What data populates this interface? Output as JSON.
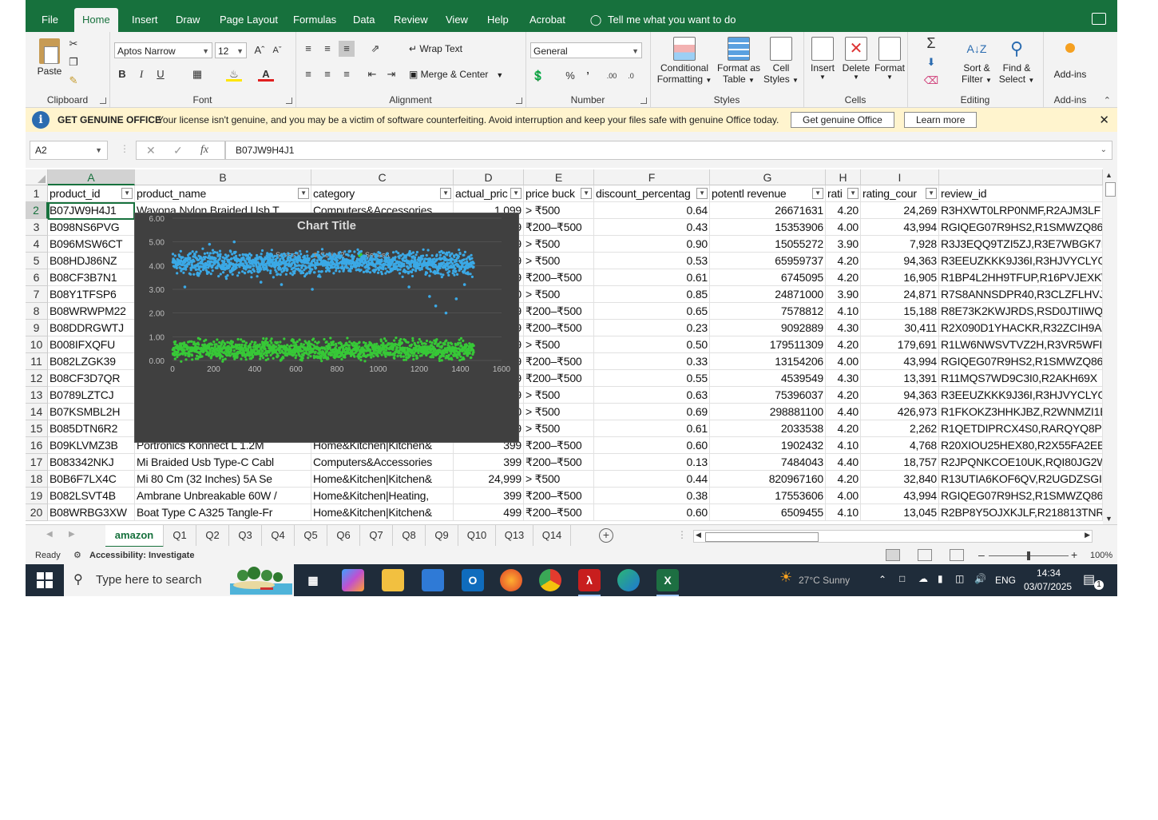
{
  "ribbon": {
    "tabs": [
      "File",
      "Home",
      "Insert",
      "Draw",
      "Page Layout",
      "Formulas",
      "Data",
      "Review",
      "View",
      "Help",
      "Acrobat"
    ],
    "active_tab": "Home",
    "tell_me": "Tell me what you want to do",
    "clipboard": {
      "paste": "Paste",
      "label": "Clipboard"
    },
    "font": {
      "name": "Aptos Narrow",
      "size": "12",
      "bold": "B",
      "italic": "I",
      "underline": "U",
      "label": "Font"
    },
    "alignment": {
      "wrap": "Wrap Text",
      "merge": "Merge & Center",
      "label": "Alignment"
    },
    "number": {
      "format": "General",
      "percent": "%",
      "comma": "’",
      "label": "Number"
    },
    "styles": {
      "conditional": "Conditional",
      "conditional2": "Formatting",
      "format_as": "Format as",
      "format_as2": "Table",
      "cell": "Cell",
      "cell2": "Styles",
      "label": "Styles"
    },
    "cells": {
      "insert": "Insert",
      "delete": "Delete",
      "format": "Format",
      "label": "Cells"
    },
    "editing": {
      "sort": "Sort &",
      "sort2": "Filter",
      "find": "Find &",
      "find2": "Select",
      "label": "Editing"
    },
    "addins": {
      "addins": "Add-ins",
      "label": "Add-ins"
    }
  },
  "banner": {
    "title": "GET GENUINE OFFICE",
    "message": "Your license isn't genuine, and you may be a victim of software counterfeiting. Avoid interruption and keep your files safe with genuine Office today.",
    "get_button": "Get genuine Office",
    "learn_button": "Learn more"
  },
  "formula_bar": {
    "name_box": "A2",
    "fx": "fx",
    "value": "B07JW9H4J1"
  },
  "columns": [
    "A",
    "B",
    "C",
    "D",
    "E",
    "F",
    "G",
    "H",
    "I"
  ],
  "headers": [
    "product_id",
    "product_name",
    "category",
    "actual_pric",
    "price buck",
    "discount_percentag",
    "potentl revenue",
    "rati",
    "rating_cour",
    "review_id"
  ],
  "rows": [
    {
      "n": "2",
      "a": "B07JW9H4J1",
      "b": "Wayona Nylon Braided Usb T",
      "c": "Computers&Accessories",
      "d": "1,099",
      "e": "> ₹500",
      "f": "0.64",
      "g": "26671631",
      "h": "4.20",
      "i": "24,269",
      "j": "R3HXWT0LRP0NMF,R2AJM3LF"
    },
    {
      "n": "3",
      "a": "B098NS6PVG",
      "b": "",
      "c": "",
      "d": "9",
      "e": "₹200–₹500",
      "f": "0.43",
      "g": "15353906",
      "h": "4.00",
      "i": "43,994",
      "j": "RGIQEG07R9HS2,R1SMWZQ86"
    },
    {
      "n": "4",
      "a": "B096MSW6CT",
      "b": "",
      "c": "",
      "d": "9",
      "e": "> ₹500",
      "f": "0.90",
      "g": "15055272",
      "h": "3.90",
      "i": "7,928",
      "j": "R3J3EQQ9TZI5ZJ,R3E7WBGK7I"
    },
    {
      "n": "5",
      "a": "B08HDJ86NZ",
      "b": "",
      "c": "",
      "d": "9",
      "e": "> ₹500",
      "f": "0.53",
      "g": "65959737",
      "h": "4.20",
      "i": "94,363",
      "j": "R3EEUZKKK9J36I,R3HJVYCLYO"
    },
    {
      "n": "6",
      "a": "B08CF3B7N1",
      "b": "",
      "c": "",
      "d": "9",
      "e": "₹200–₹500",
      "f": "0.61",
      "g": "6745095",
      "h": "4.20",
      "i": "16,905",
      "j": "R1BP4L2HH9TFUP,R16PVJEXK\\"
    },
    {
      "n": "7",
      "a": "B08Y1TFSP6",
      "b": "",
      "c": "",
      "d": "0",
      "e": "> ₹500",
      "f": "0.85",
      "g": "24871000",
      "h": "3.90",
      "i": "24,871",
      "j": "R7S8ANNSDPR40,R3CLZFLHVJ"
    },
    {
      "n": "8",
      "a": "B08WRWPM22",
      "b": "",
      "c": "",
      "d": "9",
      "e": "₹200–₹500",
      "f": "0.65",
      "g": "7578812",
      "h": "4.10",
      "i": "15,188",
      "j": "R8E73K2KWJRDS,RSD0JTIIWQ("
    },
    {
      "n": "9",
      "a": "B08DDRGWTJ",
      "b": "",
      "c": "",
      "d": "9",
      "e": "₹200–₹500",
      "f": "0.23",
      "g": "9092889",
      "h": "4.30",
      "i": "30,411",
      "j": "R2X090D1YHACKR,R32ZCIH9A"
    },
    {
      "n": "10",
      "a": "B008IFXQFU",
      "b": "",
      "c": "",
      "d": "9",
      "e": "> ₹500",
      "f": "0.50",
      "g": "179511309",
      "h": "4.20",
      "i": "179,691",
      "j": "R1LW6NWSVTVZ2H,R3VR5WFI"
    },
    {
      "n": "11",
      "a": "B082LZGK39",
      "b": "",
      "c": "",
      "d": "9",
      "e": "₹200–₹500",
      "f": "0.33",
      "g": "13154206",
      "h": "4.00",
      "i": "43,994",
      "j": "RGIQEG07R9HS2,R1SMWZQ86"
    },
    {
      "n": "12",
      "a": "B08CF3D7QR",
      "b": "",
      "c": "",
      "d": "9",
      "e": "₹200–₹500",
      "f": "0.55",
      "g": "4539549",
      "h": "4.30",
      "i": "13,391",
      "j": "R11MQS7WD9C3I0,R2AKH69X"
    },
    {
      "n": "13",
      "a": "B0789LZTCJ",
      "b": "",
      "c": "",
      "d": "9",
      "e": "> ₹500",
      "f": "0.63",
      "g": "75396037",
      "h": "4.20",
      "i": "94,363",
      "j": "R3EEUZKKK9J36I,R3HJVYCLYO"
    },
    {
      "n": "14",
      "a": "B07KSMBL2H",
      "b": "",
      "c": "",
      "d": "0",
      "e": "> ₹500",
      "f": "0.69",
      "g": "298881100",
      "h": "4.40",
      "i": "426,973",
      "j": "R1FKOKZ3HHKJBZ,R2WNMZI1E"
    },
    {
      "n": "15",
      "a": "B085DTN6R2",
      "b": "",
      "c": "",
      "d": "9",
      "e": "> ₹500",
      "f": "0.61",
      "g": "2033538",
      "h": "4.20",
      "i": "2,262",
      "j": "R1QETDIPRCX4S0,RARQYQ8P("
    },
    {
      "n": "16",
      "a": "B09KLVMZ3B",
      "b": "Portronics Konnect L 1.2M",
      "c": "Home&Kitchen|Kitchen&",
      "d": "399",
      "e": "₹200–₹500",
      "f": "0.60",
      "g": "1902432",
      "h": "4.10",
      "i": "4,768",
      "j": "R20XIOU25HEX80,R2X55FA2EE"
    },
    {
      "n": "17",
      "a": "B083342NKJ",
      "b": "Mi Braided Usb Type-C Cabl",
      "c": "Computers&Accessories",
      "d": "399",
      "e": "₹200–₹500",
      "f": "0.13",
      "g": "7484043",
      "h": "4.40",
      "i": "18,757",
      "j": "R2JPQNKCOE10UK,RQI80JG2W"
    },
    {
      "n": "18",
      "a": "B0B6F7LX4C",
      "b": "Mi 80 Cm (32 Inches) 5A Se",
      "c": "Home&Kitchen|Kitchen&",
      "d": "24,999",
      "e": "> ₹500",
      "f": "0.44",
      "g": "820967160",
      "h": "4.20",
      "i": "32,840",
      "j": "R13UTIA6KOF6QV,R2UGDZSGI"
    },
    {
      "n": "19",
      "a": "B082LSVT4B",
      "b": "Ambrane Unbreakable 60W /",
      "c": "Home&Kitchen|Heating,",
      "d": "399",
      "e": "₹200–₹500",
      "f": "0.38",
      "g": "17553606",
      "h": "4.00",
      "i": "43,994",
      "j": "RGIQEG07R9HS2,R1SMWZQ86"
    },
    {
      "n": "20",
      "a": "B08WRBG3XW",
      "b": "Boat Type C A325 Tangle-Fr",
      "c": "Home&Kitchen|Kitchen&",
      "d": "499",
      "e": "₹200–₹500",
      "f": "0.60",
      "g": "6509455",
      "h": "4.10",
      "i": "13,045",
      "j": "R2BP8Y5OJXKJLF,R218813TNR"
    }
  ],
  "chart_data": {
    "type": "scatter",
    "title": "Chart Title",
    "legend": [
      "Series1",
      "Series2",
      "Series3"
    ],
    "legend_position": "top",
    "xlim": [
      0,
      1600
    ],
    "ylim": [
      0,
      6
    ],
    "x_ticks": [
      "0",
      "200",
      "400",
      "600",
      "800",
      "1000",
      "1200",
      "1400",
      "1600"
    ],
    "y_ticks": [
      "0.00",
      "1.00",
      "2.00",
      "3.00",
      "4.00",
      "5.00",
      "6.00"
    ],
    "series": [
      {
        "name": "Series1",
        "color": "#3ba9e6",
        "x_range": [
          1,
          1465
        ],
        "y_center": 4.1,
        "y_spread": 0.35
      },
      {
        "name": "Series3",
        "color": "#37c837",
        "x_range": [
          1,
          1465
        ],
        "y_center": 0.45,
        "y_spread": 0.3
      }
    ],
    "outliers": [
      [
        180,
        4.9
      ],
      [
        300,
        5.0
      ],
      [
        430,
        3.3
      ],
      [
        530,
        3.2
      ],
      [
        680,
        3.0
      ],
      [
        1150,
        3.1
      ],
      [
        1250,
        2.7
      ],
      [
        1280,
        2.3
      ],
      [
        1330,
        2.0
      ],
      [
        1380,
        2.6
      ],
      [
        1420,
        3.2
      ],
      [
        60,
        3.1
      ]
    ]
  },
  "sheets": [
    "amazon",
    "Q1",
    "Q2",
    "Q3",
    "Q4",
    "Q5",
    "Q6",
    "Q7",
    "Q8",
    "Q9",
    "Q10",
    "Q13",
    "Q14"
  ],
  "active_sheet": "amazon",
  "status": {
    "ready": "Ready",
    "accessibility": "Accessibility: Investigate",
    "zoom": "100%"
  },
  "taskbar": {
    "search": "Type here to search",
    "weather": "27°C  Sunny",
    "lang": "ENG",
    "time": "14:34",
    "date": "03/07/2025",
    "notif": "1"
  }
}
